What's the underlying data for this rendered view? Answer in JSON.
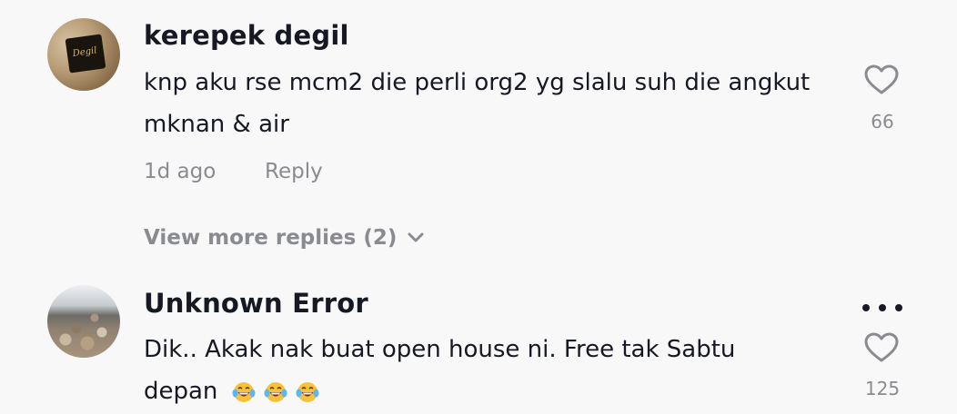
{
  "comments": [
    {
      "username": "kerepek degil",
      "avatar_text": "Degil",
      "text": "knp aku rse mcm2 die perli org2 yg slalu suh die angkut mknan & air",
      "time": "1d ago",
      "reply_label": "Reply",
      "likes": "66",
      "view_more": "View more replies (2)"
    },
    {
      "username": "Unknown Error",
      "text_line1": "Dik.. Akak nak buat open house ni. Free tak Sabtu",
      "text_line2": "depan",
      "emoji": [
        "tears-of-joy-emoji",
        "tears-of-joy-emoji",
        "tears-of-joy-emoji"
      ],
      "likes": "125"
    }
  ],
  "colors": {
    "text_primary": "#161823",
    "text_secondary": "#8a8b91",
    "background": "#f8f8f8"
  }
}
